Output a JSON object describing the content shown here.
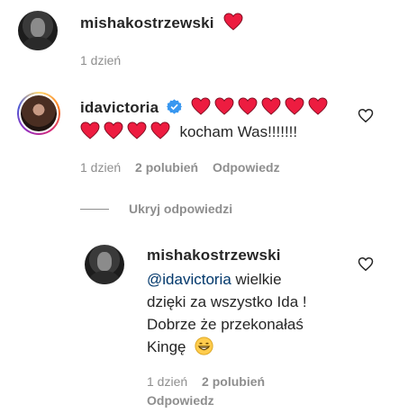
{
  "comments": [
    {
      "username": "mishakostrzewski",
      "text_hearts": 1,
      "time": "1 dzień"
    },
    {
      "username": "idavictoria",
      "verified": true,
      "hearts_line1": 6,
      "hearts_line2": 4,
      "text": "kocham Was!!!!!!!",
      "time": "1 dzień",
      "likes": "2 polubień",
      "reply": "Odpowiedz"
    }
  ],
  "hide_replies": "Ukryj odpowiedzi",
  "reply_comment": {
    "username": "mishakostrzewski",
    "mention": "@idavictoria",
    "line1_rest": " wielkie",
    "line2": "dzięki za wszystko Ida !",
    "line3": "Dobrze że przekonałaś",
    "line4": "Kingę",
    "emoji": "grinning-face-with-smiling-eyes",
    "time": "1 dzień",
    "likes": "2 polubień",
    "reply": "Odpowiedz"
  },
  "colors": {
    "heart": "#ed1c40",
    "verified": "#3897f0",
    "meta": "#8e8e8e",
    "mention": "#00376b"
  }
}
